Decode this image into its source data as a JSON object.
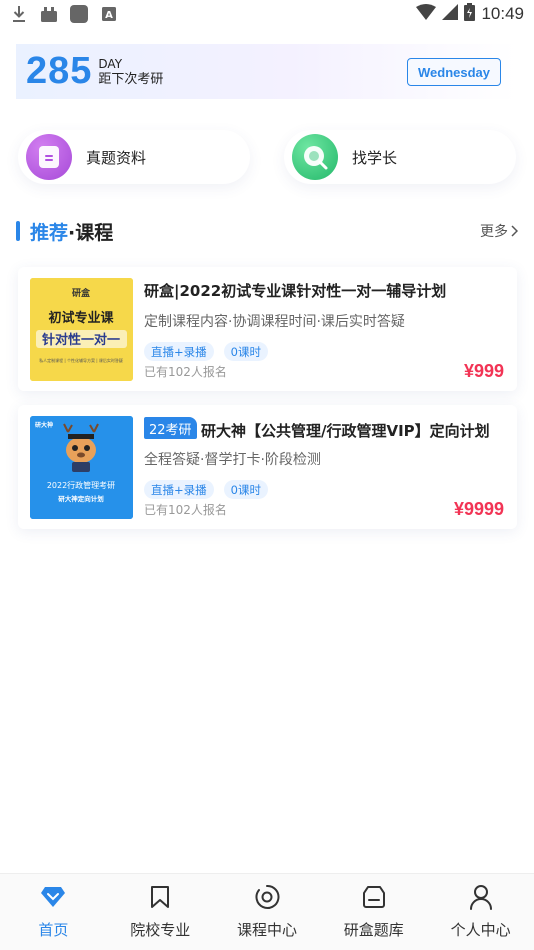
{
  "status_bar": {
    "time": "10:49",
    "left_icons": [
      "download-icon",
      "android-icon",
      "app-square-icon",
      "keyboard-a-icon"
    ],
    "right_icons": [
      "wifi-icon",
      "signal-icon",
      "battery-icon"
    ]
  },
  "countdown": {
    "days": "285",
    "unit": "DAY",
    "label": "距下次考研",
    "weekday": "Wednesday"
  },
  "shortcuts": [
    {
      "label": "真题资料",
      "icon": "document-icon",
      "color": "#b150e0"
    },
    {
      "label": "找学长",
      "icon": "chat-search-icon",
      "color": "#2cc074"
    }
  ],
  "section": {
    "title_highlight": "推荐",
    "title_rest": "·课程",
    "more_label": "更多"
  },
  "courses": [
    {
      "title": "研盒|2022初试专业课针对性一对一辅导计划",
      "subtitle": "定制课程内容·协调课程时间·课后实时答疑",
      "tags": [
        "直播+录播",
        "0课时"
      ],
      "enrolled": "已有102人报名",
      "price": "¥999",
      "thumb": {
        "brand": "研盒",
        "line1": "初试专业课",
        "line2": "针对性一对一",
        "footnote": "私人定制课程 | 个性化辅导方案 | 课后实时答疑"
      }
    },
    {
      "tag": "22考研",
      "title": "研大神【公共管理/行政管理VIP】定向计划",
      "subtitle": "全程答疑·督学打卡·阶段检测",
      "tags": [
        "直播+录播",
        "0课时"
      ],
      "enrolled": "已有102人报名",
      "price": "¥9999",
      "thumb": {
        "brand": "研大神",
        "line1": "2022行政管理考研",
        "line2": "研大神定向计划"
      }
    }
  ],
  "bottom_nav": [
    {
      "label": "首页",
      "icon": "home-diamond-icon",
      "active": true
    },
    {
      "label": "院校专业",
      "icon": "bookmark-icon",
      "active": false
    },
    {
      "label": "课程中心",
      "icon": "course-ring-icon",
      "active": false
    },
    {
      "label": "研盒题库",
      "icon": "question-bank-icon",
      "active": false
    },
    {
      "label": "个人中心",
      "icon": "user-icon",
      "active": false
    }
  ],
  "colors": {
    "accent": "#2a86e8",
    "price": "#f23455",
    "tag_bg": "#eaf3ff"
  }
}
